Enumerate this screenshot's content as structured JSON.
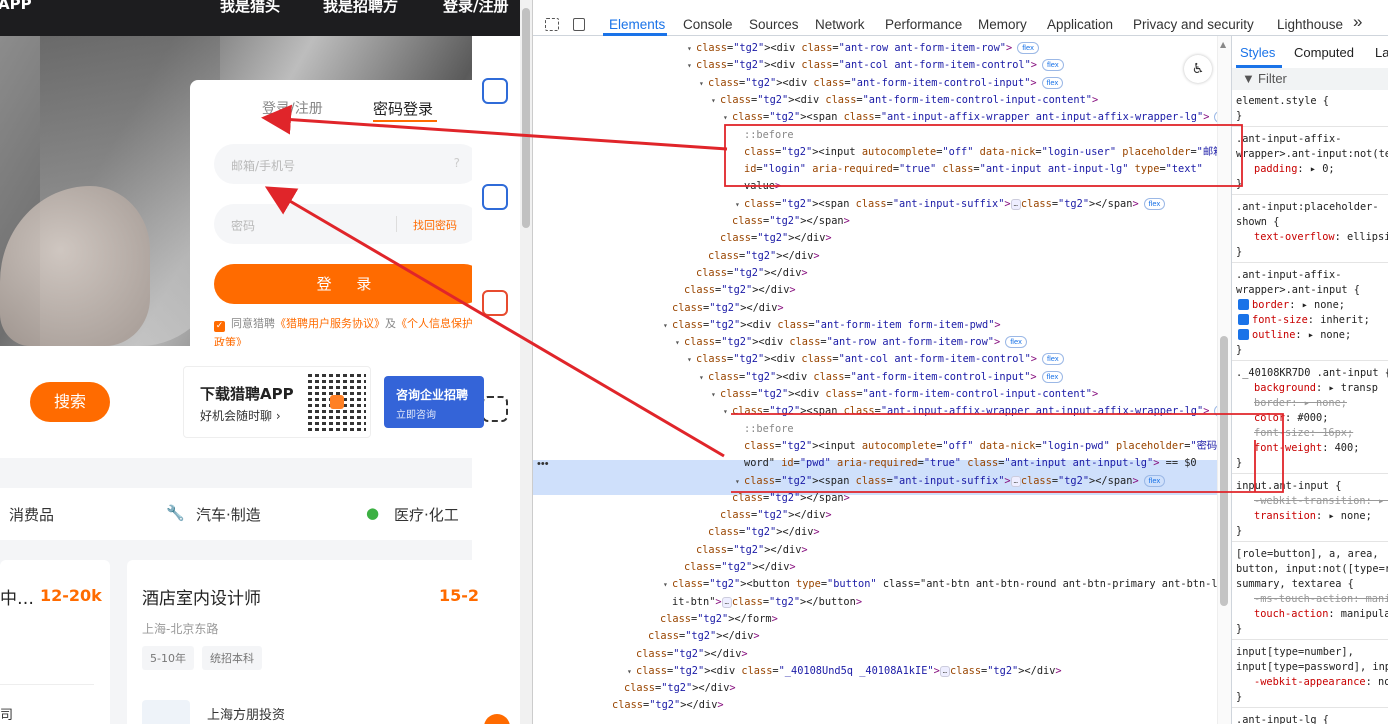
{
  "site": {
    "topnav": [
      "APP",
      "我是猎头",
      "我是招聘方",
      "登录/注册"
    ],
    "login": {
      "tab_sms": "登录/注册",
      "tab_pwd": "密码登录",
      "user_placeholder": "邮箱/手机号",
      "pwd_placeholder": "密码",
      "forgot": "找回密码",
      "submit": "登 录",
      "agree_prefix": "同意猎聘",
      "agree_link1": "《猎聘用户服务协议》",
      "agree_mid": "及",
      "agree_link2": "《个人信息保护政策》"
    },
    "search_button": "搜索",
    "app_promo": {
      "title": "下载猎聘APP",
      "subtitle": "好机会随时聊 ›"
    },
    "consult": {
      "title": "咨询企业招聘",
      "sub": "立即咨询"
    },
    "categories": [
      "消费品",
      "汽车·制造",
      "医疗·化工"
    ],
    "jobs": [
      {
        "title": "中…",
        "salary": "12-20k",
        "company": "司"
      },
      {
        "title": "酒店室内设计师",
        "salary": "15-2",
        "location": "上海-北京东路",
        "tags": [
          "5-10年",
          "统招本科"
        ],
        "company": "上海方朋投资"
      }
    ]
  },
  "devtools": {
    "tabs": [
      "Elements",
      "Console",
      "Sources",
      "Network",
      "Performance",
      "Memory",
      "Application",
      "Privacy and security",
      "Lighthouse"
    ],
    "active_tab": "Elements",
    "more": "»",
    "dom": [
      {
        "t": "<div class=\"ant-row ant-form-item-row\">",
        "badge": "flex"
      },
      {
        "t": "<div class=\"ant-col ant-form-item-control\">",
        "badge": "flex"
      },
      {
        "t": "<div class=\"ant-form-item-control-input\">",
        "badge": "flex"
      },
      {
        "t": "<div class=\"ant-form-item-control-input-content\">",
        "badge": ""
      },
      {
        "t": "<span class=\"ant-input-affix-wrapper ant-input-affix-wrapper-lg\">",
        "badge": "flex"
      },
      {
        "t": "::before",
        "badge": ""
      },
      {
        "t": "<input autocomplete=\"off\" data-nick=\"login-user\" placeholder=\"邮箱/手机号\"",
        "badge": ""
      },
      {
        "t": "id=\"login\" aria-required=\"true\" class=\"ant-input ant-input-lg\" type=\"text\"",
        "badge": ""
      },
      {
        "t": "value>",
        "badge": ""
      },
      {
        "t": "<span class=\"ant-input-suffix\">…</span>",
        "badge": "flex"
      },
      {
        "t": "</span>",
        "badge": ""
      },
      {
        "t": "</div>",
        "badge": ""
      },
      {
        "t": "</div>",
        "badge": ""
      },
      {
        "t": "</div>",
        "badge": ""
      },
      {
        "t": "</div>",
        "badge": ""
      },
      {
        "t": "</div>",
        "badge": ""
      },
      {
        "t": "<div class=\"ant-form-item form-item-pwd\">",
        "badge": ""
      },
      {
        "t": "<div class=\"ant-row ant-form-item-row\">",
        "badge": "flex"
      },
      {
        "t": "<div class=\"ant-col ant-form-item-control\">",
        "badge": "flex"
      },
      {
        "t": "<div class=\"ant-form-item-control-input\">",
        "badge": "flex"
      },
      {
        "t": "<div class=\"ant-form-item-control-input-content\">",
        "badge": ""
      },
      {
        "t": "<span class=\"ant-input-affix-wrapper ant-input-affix-wrapper-lg\">",
        "badge": "flex"
      },
      {
        "t": "::before",
        "badge": ""
      },
      {
        "t": "<input autocomplete=\"off\" data-nick=\"login-pwd\" placeholder=\"密码\" type=\"pass",
        "badge": ""
      },
      {
        "t": "word\" id=\"pwd\" aria-required=\"true\" class=\"ant-input ant-input-lg\"> == $0",
        "badge": ""
      },
      {
        "t": "<span class=\"ant-input-suffix\">…</span>",
        "badge": "flex"
      },
      {
        "t": "</span>",
        "badge": ""
      },
      {
        "t": "</div>",
        "badge": ""
      },
      {
        "t": "</div>",
        "badge": ""
      },
      {
        "t": "</div>",
        "badge": ""
      },
      {
        "t": "</div>",
        "badge": ""
      },
      {
        "t": "<button type=\"button\" class=\"ant-btn ant-btn-round ant-btn-primary ant-btn-lg login-subm",
        "badge": ""
      },
      {
        "t": "it-btn\">…</button>",
        "badge": ""
      },
      {
        "t": "</form>",
        "badge": ""
      },
      {
        "t": "</div>",
        "badge": ""
      },
      {
        "t": "</div>",
        "badge": ""
      },
      {
        "t": "<div class=\"_40108Und5q _40108A1kIE\">…</div>",
        "badge": ""
      },
      {
        "t": "</div>",
        "badge": ""
      },
      {
        "t": "</div>",
        "badge": ""
      }
    ],
    "styles": {
      "tabs": [
        "Styles",
        "Computed",
        "La"
      ],
      "filter": "Filter",
      "rules": [
        "element.style {",
        "}",
        ".ant-input-affix-",
        "wrapper>.ant-input:not(tex",
        "padding: ▸ 0;",
        "}",
        ".ant-input:placeholder-",
        "shown {",
        "text-overflow: ellipsi",
        "}",
        ".ant-input-affix-",
        "wrapper>.ant-input {",
        "border: ▸ none;",
        "font-size: inherit;",
        "outline: ▸ none;",
        "}",
        "._40108KR7D0 .ant-input {",
        "background: ▸ transp",
        "border: ▸ none;",
        "color: #000;",
        "font-size: 16px;",
        "font-weight: 400;",
        "}",
        "input.ant-input {",
        "-webkit-transition: ▸ a",
        "transition: ▸ none;",
        "}",
        "[role=button], a, area,",
        "button, input:not([type=ra",
        "summary, textarea {",
        "-ms-touch-action: mani",
        "touch-action: manipula",
        "}",
        "input[type=number],",
        "input[type=password], inpu",
        "-webkit-appearance: no",
        "}",
        ".ant-input-lg {",
        "font-size: 16px;",
        "padding: 6.5px 11px;"
      ]
    }
  },
  "colors": {
    "brand": "#ff6b00",
    "devtools_accent": "#1a73e8",
    "annotation": "#e0252a",
    "selected_row": "#cfe0fb"
  }
}
